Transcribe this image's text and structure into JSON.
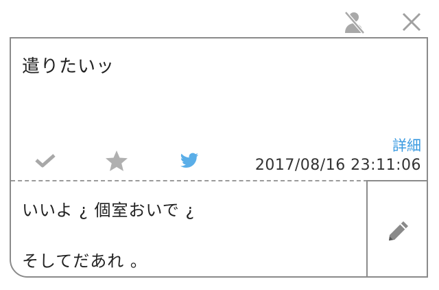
{
  "toolbar": {
    "anonymous_icon": "anonymous-person-slash-icon",
    "close_icon": "close-x-icon"
  },
  "message": {
    "text": "遣りたいッ"
  },
  "detail_link": "詳細",
  "actions": {
    "check_icon": "check-icon",
    "star_icon": "star-icon",
    "twitter_icon": "twitter-bird-icon"
  },
  "timestamp": "2017/08/16 23:11:06",
  "reply": {
    "line1": "いいよ ¿ 個室おいで ¿",
    "line2": "そしてだあれ 。"
  },
  "edit": {
    "icon": "pencil-icon"
  },
  "colors": {
    "icon_gray": "#a8a8a8",
    "border_gray": "#8a8a8a",
    "link_blue": "#3a9ae0",
    "twitter_blue": "#5aaee8"
  }
}
